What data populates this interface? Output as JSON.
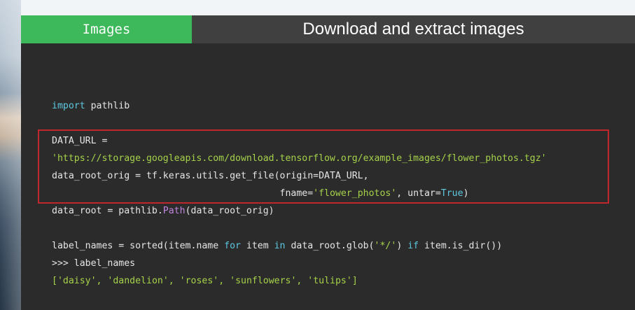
{
  "header": {
    "tab_label": "Images",
    "title": "Download and extract images"
  },
  "code": {
    "l1_kw": "import",
    "l1_rest": " pathlib",
    "l2": "DATA_URL =",
    "l3_str": "'https://storage.googleapis.com/download.tensorflow.org/example_images/flower_photos.tgz'",
    "l4": "data_root_orig = tf.keras.utils.get_file(origin=DATA_URL,",
    "l5_pre": "                                         fname=",
    "l5_str": "'flower_photos'",
    "l5_mid": ", untar=",
    "l5_const": "True",
    "l5_end": ")",
    "l6_pre": "data_root = pathlib.",
    "l6_bi": "Path",
    "l6_end": "(data_root_orig)",
    "l7_a": "label_names = sorted(item.name ",
    "l7_for": "for",
    "l7_b": " item ",
    "l7_in": "in",
    "l7_c": " data_root.glob(",
    "l7_str": "'*/'",
    "l7_d": ") ",
    "l7_if": "if",
    "l7_e": " item.is_dir())",
    "l8": ">>> label_names",
    "l9_open": "[",
    "l9_s1": "'daisy'",
    "l9_s2": "'dandelion'",
    "l9_s3": "'roses'",
    "l9_s4": "'sunflowers'",
    "l9_s5": "'tulips'",
    "l9_sep": ", ",
    "l9_close": "]"
  },
  "colors": {
    "tab_green": "#3db85a",
    "slide_bg": "#2b2b2b",
    "highlight_border": "#c0272d",
    "keyword": "#5ec8e0",
    "string": "#a6d24a",
    "builtin": "#c184e0"
  }
}
